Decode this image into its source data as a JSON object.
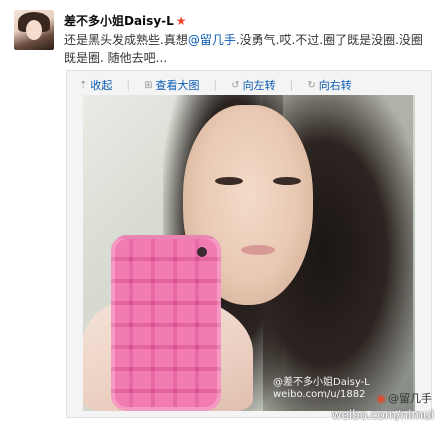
{
  "post": {
    "username": "差不多小姐Daisy-L",
    "badge_icon": "star-icon",
    "text_before": "还是黑头发成熟些.真想",
    "mention": "@留几手",
    "text_after": ".没勇气.哎.不过.圈了既是没圈.没圈既是圈. 随他去吧..."
  },
  "toolbar": {
    "collapse": "收起",
    "view_large": "查看大图",
    "rotate_left": "向左转",
    "rotate_right": "向右转"
  },
  "photo": {
    "watermark_name": "@差不多小姐Daisy-L",
    "watermark_url": "weibo.com/u/1882"
  },
  "overlay_watermark": {
    "handle": "@留几手",
    "url": "weibo.com/nimui"
  }
}
